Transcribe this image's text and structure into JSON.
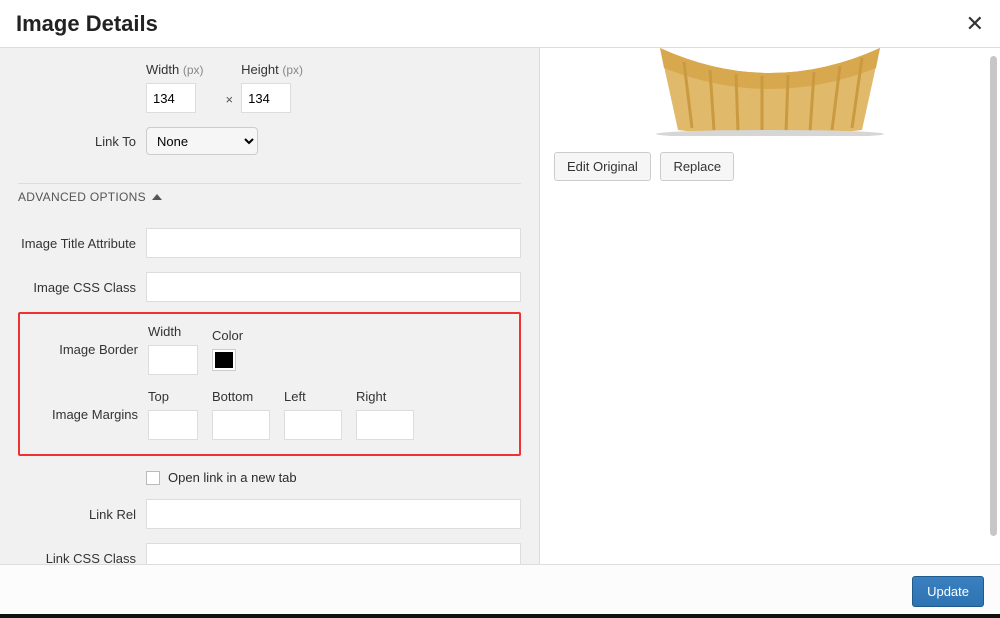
{
  "dialog": {
    "title": "Image Details",
    "update_button": "Update"
  },
  "size": {
    "width_label": "Width",
    "height_label": "Height",
    "unit": "(px)",
    "width_value": "134",
    "height_value": "134"
  },
  "link_to": {
    "label": "Link To",
    "selected": "None"
  },
  "advanced": {
    "header": "ADVANCED OPTIONS",
    "title_attr_label": "Image Title Attribute",
    "title_attr_value": "",
    "css_class_label": "Image CSS Class",
    "css_class_value": "",
    "border": {
      "row_label": "Image Border",
      "width_label": "Width",
      "color_label": "Color",
      "width_value": "",
      "color_value": "#000000"
    },
    "margins": {
      "row_label": "Image Margins",
      "top_label": "Top",
      "bottom_label": "Bottom",
      "left_label": "Left",
      "right_label": "Right",
      "top_value": "",
      "bottom_value": "",
      "left_value": "",
      "right_value": ""
    },
    "new_tab_label": "Open link in a new tab",
    "new_tab_checked": false,
    "link_rel_label": "Link Rel",
    "link_rel_value": "",
    "link_css_label": "Link CSS Class",
    "link_css_value": ""
  },
  "preview": {
    "edit_original": "Edit Original",
    "replace": "Replace"
  }
}
